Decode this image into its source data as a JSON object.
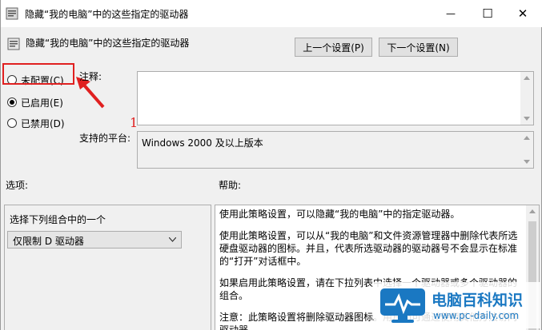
{
  "window": {
    "title": "隐藏“我的电脑”中的这些指定的驱动器",
    "minimize_symbol": "—",
    "maximize_symbol": "☐",
    "close_symbol": "✕"
  },
  "header": {
    "policy_title": "隐藏“我的电脑”中的这些指定的驱动器",
    "prev_setting_label": "上一个设置(P)",
    "next_setting_label": "下一个设置(N)"
  },
  "state": {
    "options": [
      {
        "label": "未配置(C)",
        "checked": false
      },
      {
        "label": "已启用(E)",
        "checked": true
      },
      {
        "label": "已禁用(D)",
        "checked": false
      }
    ]
  },
  "annotation": {
    "number": "1",
    "color": "#e02020"
  },
  "comment": {
    "label": "注释:",
    "value": ""
  },
  "supported": {
    "label": "支持的平台:",
    "value": "Windows 2000 及以上版本"
  },
  "options_pane": {
    "label": "选项:",
    "combo_caption": "选择下列组合中的一个",
    "dropdown_value": "仅限制 D 驱动器"
  },
  "help_pane": {
    "label": "帮助:",
    "paragraphs": [
      "使用此策略设置，可以隐藏“我的电脑”中的指定驱动器。",
      "使用此策略设置，可以从“我的电脑”和文件资源管理器中删除代表所选硬盘驱动器的图标。并且，代表所选驱动器的驱动器号不会显示在标准的“打开”对话框中。",
      "如果启用此策略设置，请在下拉列表中选择一个驱动器或多个驱动器的组合。",
      "注意：此策略设置将删除驱动器图标。用户仍可通过使用其他方法访问驱动器"
    ]
  },
  "watermark": {
    "title": "电脑百科知识",
    "url": "www.pc-daily.com",
    "brand_color": "#1a78c2"
  }
}
